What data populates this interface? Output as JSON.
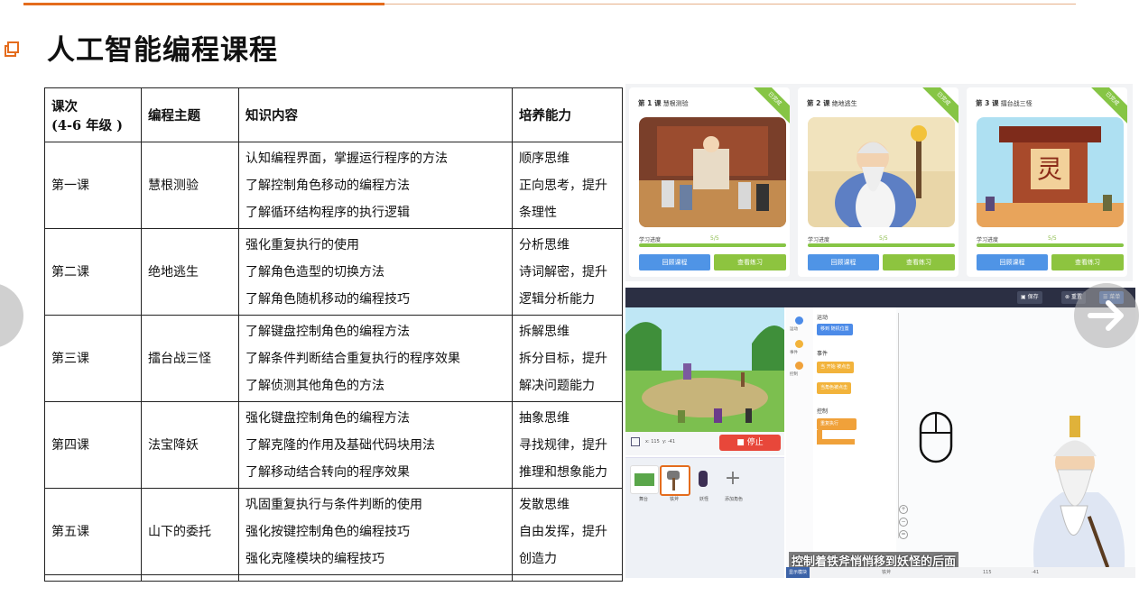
{
  "page": {
    "title": "人工智能编程课程"
  },
  "table": {
    "headers": [
      {
        "line1": "课次",
        "line2": "(4-6 年级 )"
      },
      {
        "line1": "编程主题"
      },
      {
        "line1": "知识内容"
      },
      {
        "line1": "培养能力"
      }
    ],
    "rows": [
      {
        "lesson": "第一课",
        "topic": "慧根测验",
        "knowledge": [
          "认知编程界面，掌握运行程序的方法",
          "了解控制角色移动的编程方法",
          "了解循环结构程序的执行逻辑"
        ],
        "ability": [
          "顺序思维",
          "正向思考，提升",
          "条理性"
        ]
      },
      {
        "lesson": "第二课",
        "topic": "绝地逃生",
        "knowledge": [
          "强化重复执行的使用",
          "了解角色造型的切换方法",
          "了解角色随机移动的编程技巧"
        ],
        "ability": [
          "分析思维",
          "诗词解密，提升",
          "逻辑分析能力"
        ]
      },
      {
        "lesson": "第三课",
        "topic": "擂台战三怪",
        "knowledge": [
          "了解键盘控制角色的编程方法",
          "了解条件判断结合重复执行的程序效果",
          "了解侦测其他角色的方法"
        ],
        "ability": [
          "拆解思维",
          "拆分目标，提升",
          "解决问题能力"
        ]
      },
      {
        "lesson": "第四课",
        "topic": "法宝降妖",
        "knowledge": [
          "强化键盘控制角色的编程方法",
          "了解克隆的作用及基础代码块用法",
          "了解移动结合转向的程序效果"
        ],
        "ability": [
          "抽象思维",
          "寻找规律，提升",
          "推理和想象能力"
        ]
      },
      {
        "lesson": "第五课",
        "topic": "山下的委托",
        "knowledge": [
          "巩固重复执行与条件判断的使用",
          "强化按键控制角色的编程技巧",
          "强化克隆模块的编程技巧"
        ],
        "ability": [
          "发散思维",
          "自由发挥，提升",
          "创造力"
        ]
      }
    ]
  },
  "cards": [
    {
      "num": "第 1 课",
      "name": "慧根测验",
      "badge": "已完成",
      "progress_label": "学习进度",
      "progress_value": "5/5",
      "progress": 1.0,
      "btn_review": "回顾课程",
      "btn_practice": "查看练习"
    },
    {
      "num": "第 2 课",
      "name": "绝地逃生",
      "badge": "已完成",
      "progress_label": "学习进度",
      "progress_value": "5/5",
      "progress": 1.0,
      "btn_review": "回顾课程",
      "btn_practice": "查看练习"
    },
    {
      "num": "第 3 课",
      "name": "擂台战三怪",
      "badge": "已完成",
      "progress_label": "学习进度",
      "progress_value": "5/5",
      "progress": 1.0,
      "btn_review": "回顾课程",
      "btn_practice": "查看练习"
    }
  ],
  "editor": {
    "save": "保存",
    "reset": "重置",
    "menu": "菜单",
    "stop": "停止",
    "coord_x": "x: 115",
    "coord_y": "y: -41",
    "categories": [
      "运动",
      "事件",
      "控制"
    ],
    "block_heads": [
      "运动",
      "事件",
      "控制"
    ],
    "blocks": [
      "移到 随机位置",
      "当 开始 被点击",
      "当角色被点击",
      "重复执行"
    ],
    "sprites": [
      "舞台",
      "铁斧",
      "妖怪",
      "添加角色"
    ],
    "subtitle": "控制着铁斧悄悄移到妖怪的后面",
    "bottom_label": "铁斧",
    "bottom_left": "显示模块",
    "bottom_x": "115",
    "bottom_y": "-41"
  },
  "colors": {
    "accent": "#e46c1d",
    "green": "#86c545",
    "blue": "#4f94e6",
    "stop": "#e8473a"
  }
}
